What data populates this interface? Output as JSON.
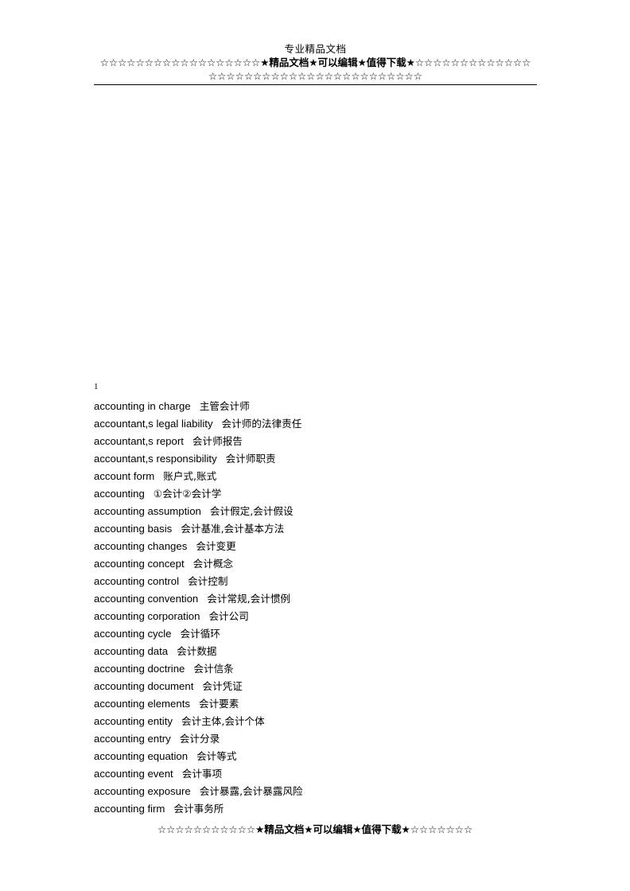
{
  "header": {
    "title": "专业精品文档",
    "stars_line2_left": "☆☆☆☆☆☆☆☆☆☆☆☆☆☆☆☆☆☆",
    "stars_line2_emph": "★精品文档★可以编辑★值得下载★",
    "stars_line2_right": "☆☆☆☆☆☆☆☆☆☆☆☆☆",
    "stars_line3": "☆☆☆☆☆☆☆☆☆☆☆☆☆☆☆☆☆☆☆☆☆☆☆☆"
  },
  "content": {
    "page_marker": "1",
    "entries": [
      {
        "term": "accounting in charge",
        "gloss": "主管会计师"
      },
      {
        "term": "accountant,s legal liability",
        "gloss": "会计师的法律责任"
      },
      {
        "term": "accountant,s report",
        "gloss": "会计师报告"
      },
      {
        "term": "accountant,s responsibility",
        "gloss": "会计师职责"
      },
      {
        "term": "account form",
        "gloss": "账户式,账式"
      },
      {
        "term": "accounting",
        "gloss": "①会计②会计学"
      },
      {
        "term": "accounting assumption",
        "gloss": "会计假定,会计假设"
      },
      {
        "term": "accounting basis",
        "gloss": "会计基准,会计基本方法"
      },
      {
        "term": "accounting changes",
        "gloss": "会计变更"
      },
      {
        "term": "accounting concept",
        "gloss": "会计概念"
      },
      {
        "term": "accounting control",
        "gloss": "会计控制"
      },
      {
        "term": "accounting convention",
        "gloss": "会计常规,会计惯例"
      },
      {
        "term": "accounting corporation",
        "gloss": "会计公司"
      },
      {
        "term": "accounting cycle",
        "gloss": "会计循环"
      },
      {
        "term": "accounting data",
        "gloss": "会计数据"
      },
      {
        "term": "accounting doctrine",
        "gloss": "会计信条"
      },
      {
        "term": "accounting document",
        "gloss": "会计凭证"
      },
      {
        "term": "accounting elements",
        "gloss": "会计要素"
      },
      {
        "term": "accounting entity",
        "gloss": "会计主体,会计个体"
      },
      {
        "term": "accounting entry",
        "gloss": "会计分录"
      },
      {
        "term": "accounting equation",
        "gloss": "会计等式"
      },
      {
        "term": "accounting event",
        "gloss": "会计事项"
      },
      {
        "term": "accounting exposure",
        "gloss": "会计暴露,会计暴露风险"
      },
      {
        "term": "accounting firm",
        "gloss": "会计事务所"
      }
    ]
  },
  "footer": {
    "stars_left": "☆☆☆☆☆☆☆☆☆☆☆",
    "stars_emph": "★精品文档★可以编辑★值得下载★",
    "stars_right": "☆☆☆☆☆☆☆"
  }
}
